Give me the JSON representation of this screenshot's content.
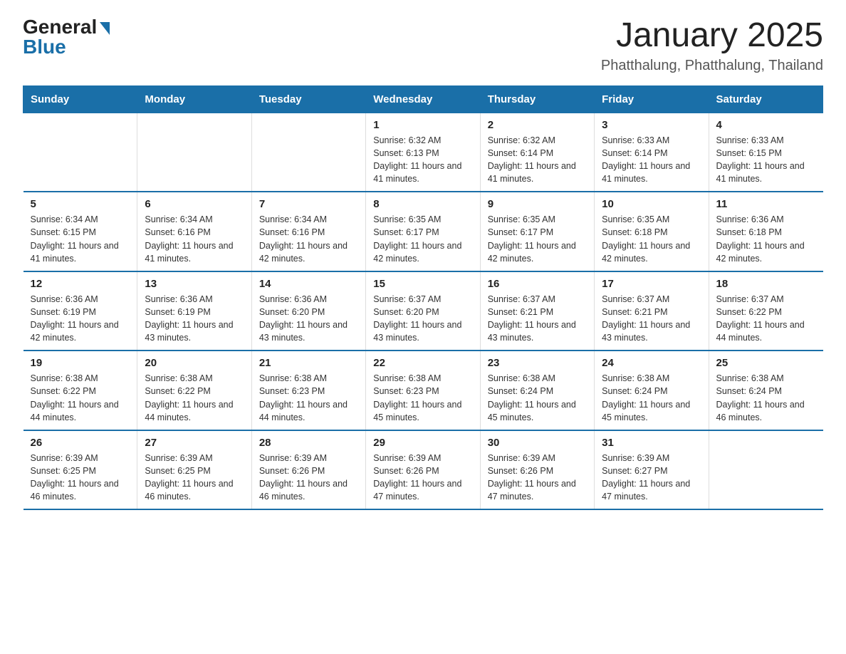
{
  "logo": {
    "general": "General",
    "blue": "Blue"
  },
  "title": "January 2025",
  "location": "Phatthalung, Phatthalung, Thailand",
  "days_of_week": [
    "Sunday",
    "Monday",
    "Tuesday",
    "Wednesday",
    "Thursday",
    "Friday",
    "Saturday"
  ],
  "weeks": [
    [
      {
        "day": "",
        "info": ""
      },
      {
        "day": "",
        "info": ""
      },
      {
        "day": "",
        "info": ""
      },
      {
        "day": "1",
        "info": "Sunrise: 6:32 AM\nSunset: 6:13 PM\nDaylight: 11 hours and 41 minutes."
      },
      {
        "day": "2",
        "info": "Sunrise: 6:32 AM\nSunset: 6:14 PM\nDaylight: 11 hours and 41 minutes."
      },
      {
        "day": "3",
        "info": "Sunrise: 6:33 AM\nSunset: 6:14 PM\nDaylight: 11 hours and 41 minutes."
      },
      {
        "day": "4",
        "info": "Sunrise: 6:33 AM\nSunset: 6:15 PM\nDaylight: 11 hours and 41 minutes."
      }
    ],
    [
      {
        "day": "5",
        "info": "Sunrise: 6:34 AM\nSunset: 6:15 PM\nDaylight: 11 hours and 41 minutes."
      },
      {
        "day": "6",
        "info": "Sunrise: 6:34 AM\nSunset: 6:16 PM\nDaylight: 11 hours and 41 minutes."
      },
      {
        "day": "7",
        "info": "Sunrise: 6:34 AM\nSunset: 6:16 PM\nDaylight: 11 hours and 42 minutes."
      },
      {
        "day": "8",
        "info": "Sunrise: 6:35 AM\nSunset: 6:17 PM\nDaylight: 11 hours and 42 minutes."
      },
      {
        "day": "9",
        "info": "Sunrise: 6:35 AM\nSunset: 6:17 PM\nDaylight: 11 hours and 42 minutes."
      },
      {
        "day": "10",
        "info": "Sunrise: 6:35 AM\nSunset: 6:18 PM\nDaylight: 11 hours and 42 minutes."
      },
      {
        "day": "11",
        "info": "Sunrise: 6:36 AM\nSunset: 6:18 PM\nDaylight: 11 hours and 42 minutes."
      }
    ],
    [
      {
        "day": "12",
        "info": "Sunrise: 6:36 AM\nSunset: 6:19 PM\nDaylight: 11 hours and 42 minutes."
      },
      {
        "day": "13",
        "info": "Sunrise: 6:36 AM\nSunset: 6:19 PM\nDaylight: 11 hours and 43 minutes."
      },
      {
        "day": "14",
        "info": "Sunrise: 6:36 AM\nSunset: 6:20 PM\nDaylight: 11 hours and 43 minutes."
      },
      {
        "day": "15",
        "info": "Sunrise: 6:37 AM\nSunset: 6:20 PM\nDaylight: 11 hours and 43 minutes."
      },
      {
        "day": "16",
        "info": "Sunrise: 6:37 AM\nSunset: 6:21 PM\nDaylight: 11 hours and 43 minutes."
      },
      {
        "day": "17",
        "info": "Sunrise: 6:37 AM\nSunset: 6:21 PM\nDaylight: 11 hours and 43 minutes."
      },
      {
        "day": "18",
        "info": "Sunrise: 6:37 AM\nSunset: 6:22 PM\nDaylight: 11 hours and 44 minutes."
      }
    ],
    [
      {
        "day": "19",
        "info": "Sunrise: 6:38 AM\nSunset: 6:22 PM\nDaylight: 11 hours and 44 minutes."
      },
      {
        "day": "20",
        "info": "Sunrise: 6:38 AM\nSunset: 6:22 PM\nDaylight: 11 hours and 44 minutes."
      },
      {
        "day": "21",
        "info": "Sunrise: 6:38 AM\nSunset: 6:23 PM\nDaylight: 11 hours and 44 minutes."
      },
      {
        "day": "22",
        "info": "Sunrise: 6:38 AM\nSunset: 6:23 PM\nDaylight: 11 hours and 45 minutes."
      },
      {
        "day": "23",
        "info": "Sunrise: 6:38 AM\nSunset: 6:24 PM\nDaylight: 11 hours and 45 minutes."
      },
      {
        "day": "24",
        "info": "Sunrise: 6:38 AM\nSunset: 6:24 PM\nDaylight: 11 hours and 45 minutes."
      },
      {
        "day": "25",
        "info": "Sunrise: 6:38 AM\nSunset: 6:24 PM\nDaylight: 11 hours and 46 minutes."
      }
    ],
    [
      {
        "day": "26",
        "info": "Sunrise: 6:39 AM\nSunset: 6:25 PM\nDaylight: 11 hours and 46 minutes."
      },
      {
        "day": "27",
        "info": "Sunrise: 6:39 AM\nSunset: 6:25 PM\nDaylight: 11 hours and 46 minutes."
      },
      {
        "day": "28",
        "info": "Sunrise: 6:39 AM\nSunset: 6:26 PM\nDaylight: 11 hours and 46 minutes."
      },
      {
        "day": "29",
        "info": "Sunrise: 6:39 AM\nSunset: 6:26 PM\nDaylight: 11 hours and 47 minutes."
      },
      {
        "day": "30",
        "info": "Sunrise: 6:39 AM\nSunset: 6:26 PM\nDaylight: 11 hours and 47 minutes."
      },
      {
        "day": "31",
        "info": "Sunrise: 6:39 AM\nSunset: 6:27 PM\nDaylight: 11 hours and 47 minutes."
      },
      {
        "day": "",
        "info": ""
      }
    ]
  ]
}
